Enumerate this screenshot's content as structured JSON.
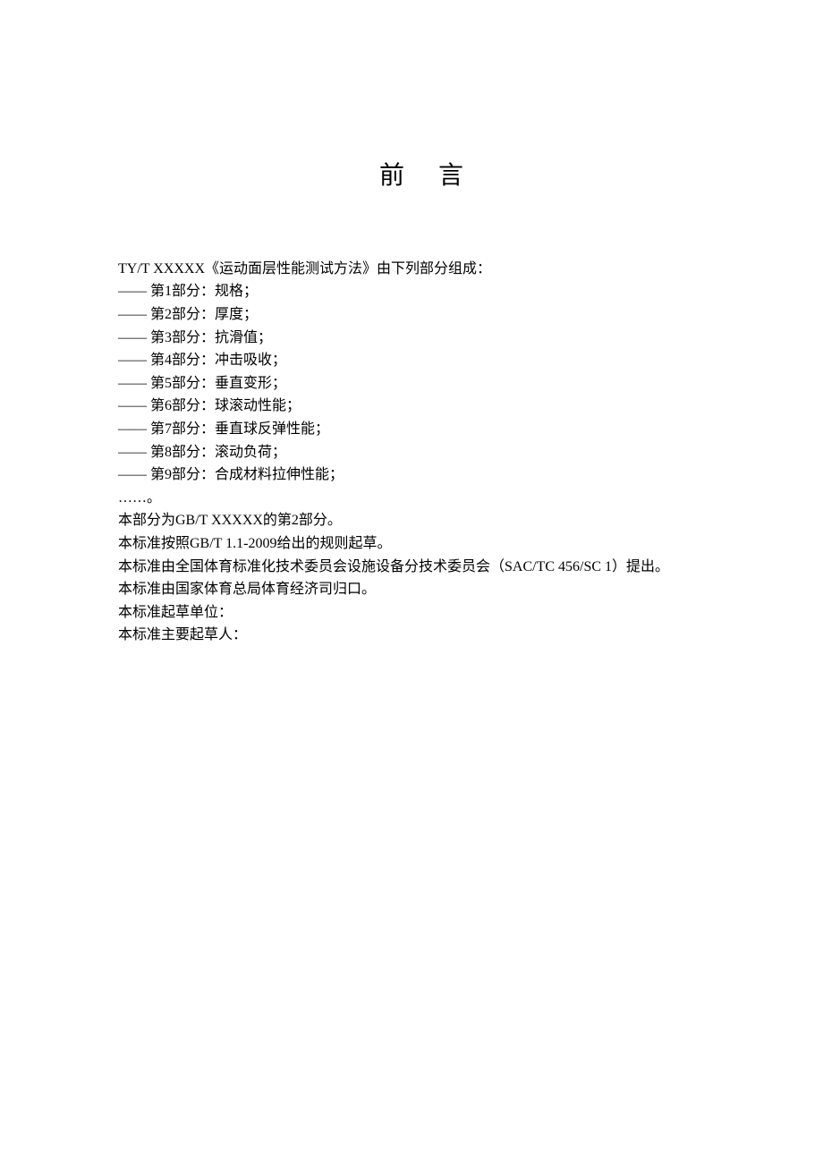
{
  "title": "前言",
  "intro": "TY/T XXXXX《运动面层性能测试方法》由下列部分组成：",
  "parts": [
    "—— 第1部分：规格；",
    "—— 第2部分：厚度；",
    "—— 第3部分：抗滑值；",
    "—— 第4部分：冲击吸收；",
    "—— 第5部分：垂直变形；",
    "—— 第6部分：球滚动性能；",
    "—— 第7部分：垂直球反弹性能；",
    "—— 第8部分：滚动负荷；",
    "—— 第9部分：合成材料拉伸性能；"
  ],
  "ellipsis": "……。",
  "statements": [
    "本部分为GB/T XXXXX的第2部分。",
    "本标准按照GB/T 1.1-2009给出的规则起草。",
    "本标准由全国体育标准化技术委员会设施设备分技术委员会（SAC/TC 456/SC 1）提出。",
    "本标准由国家体育总局体育经济司归口。",
    "本标准起草单位：",
    "本标准主要起草人："
  ]
}
